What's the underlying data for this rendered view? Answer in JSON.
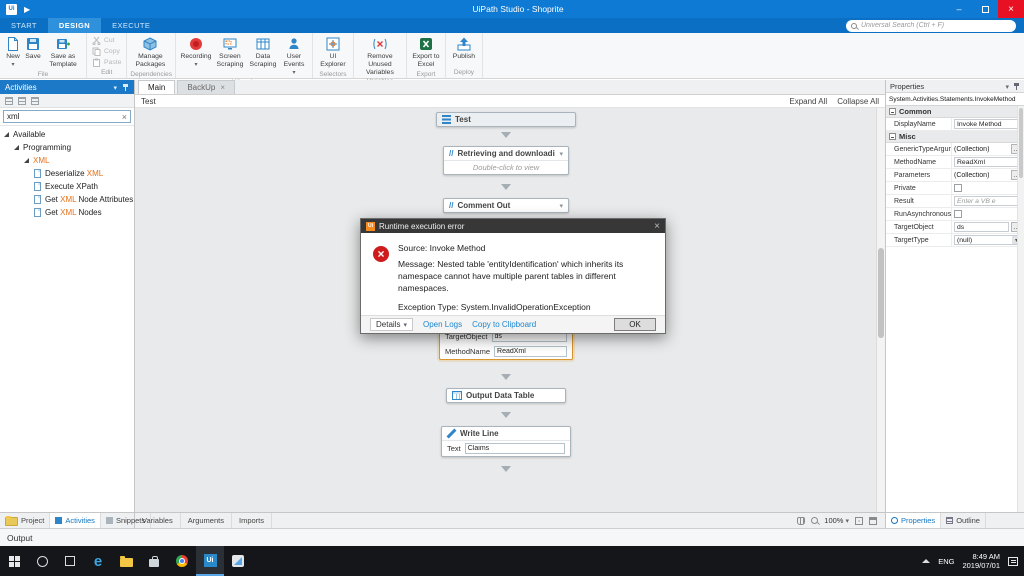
{
  "titlebar": {
    "title": "UiPath Studio - Shoprite"
  },
  "ribbon": {
    "tabs": [
      {
        "label": "START"
      },
      {
        "label": "DESIGN"
      },
      {
        "label": "EXECUTE"
      }
    ],
    "search_placeholder": "Universal Search (Ctrl + F)",
    "file": {
      "new": "New",
      "save": "Save",
      "save_as_template": "Save as Template",
      "label": "File"
    },
    "edit": {
      "cut": "Cut",
      "copy": "Copy",
      "paste": "Paste",
      "label": "Edit"
    },
    "dependencies": {
      "manage_packages": "Manage Packages",
      "label": "Dependencies"
    },
    "wizards": {
      "recording": "Recording",
      "screen_scraping": "Screen Scraping",
      "data_scraping": "Data Scraping",
      "user_events": "User Events",
      "label": "Wizards"
    },
    "selectors": {
      "ui_explorer": "UI Explorer",
      "label": "Selectors"
    },
    "variables": {
      "remove_unused": "Remove Unused Variables",
      "label": "Variables"
    },
    "export": {
      "export_to_excel": "Export to Excel",
      "label": "Export"
    },
    "deploy": {
      "publish": "Publish",
      "label": "Deploy"
    }
  },
  "activities_panel": {
    "title": "Activities",
    "search_value": "xml",
    "tree": {
      "available": "Available",
      "programming": "Programming",
      "xml_group": "XML",
      "items": [
        {
          "pre": "Deserialize ",
          "match": "XML",
          "post": ""
        },
        {
          "pre": "Execute XPath",
          "match": "",
          "post": ""
        },
        {
          "pre": "Get ",
          "match": "XML",
          "post": " Node Attributes"
        },
        {
          "pre": "Get ",
          "match": "XML",
          "post": " Nodes"
        }
      ]
    }
  },
  "designer": {
    "tabs": {
      "main": "Main",
      "backup": "BackUp"
    },
    "breadcrumb": "Test",
    "expand_all": "Expand All",
    "collapse_all": "Collapse All",
    "sequence_title": "Test",
    "retrieve_title": "Retrieving and downloadin",
    "retrieve_subtitle": "Double-click to view",
    "comment_out_title": "Comment Out",
    "invoke_fields": [
      {
        "label": "TargetObject",
        "value": "ds"
      },
      {
        "label": "MethodName",
        "value": "ReadXml"
      }
    ],
    "output_data_table_title": "Output Data Table",
    "write_line_title": "Write Line",
    "write_line_label": "Text",
    "write_line_value": "Claims",
    "statusbar": {
      "variables": "Variables",
      "arguments": "Arguments",
      "imports": "Imports",
      "zoom": "100%"
    }
  },
  "dialog": {
    "title": "Runtime execution error",
    "source": "Source: Invoke Method",
    "message": "Message: Nested table 'entityIdentification' which inherits its namespace cannot have multiple parent tables in different namespaces.",
    "exception": "Exception Type: System.InvalidOperationException",
    "details_label": "Details",
    "open_logs": "Open Logs",
    "copy_to_clipboard": "Copy to Clipboard",
    "ok": "OK"
  },
  "properties_panel": {
    "title": "Properties",
    "class_name": "System.Activities.Statements.InvokeMethod",
    "common_label": "Common",
    "misc_label": "Misc",
    "rows": {
      "display_name": {
        "label": "DisplayName",
        "value": "Invoke Method"
      },
      "generic_type_arguments": {
        "label": "GenericTypeArguments",
        "value": "(Collection)"
      },
      "method_name": {
        "label": "MethodName",
        "value": "ReadXml"
      },
      "parameters": {
        "label": "Parameters",
        "value": "(Collection)"
      },
      "private": {
        "label": "Private"
      },
      "result": {
        "label": "Result",
        "placeholder": "Enter a VB e"
      },
      "run_asynchronously": {
        "label": "RunAsynchronously"
      },
      "target_object": {
        "label": "TargetObject",
        "value": "ds"
      },
      "target_type": {
        "label": "TargetType",
        "value": "(null)"
      }
    }
  },
  "bottom_bar": {
    "project": "Project",
    "activities": "Activities",
    "snippets": "Snippets",
    "properties": "Properties",
    "outline": "Outline"
  },
  "output_panel": {
    "title": "Output"
  },
  "taskbar": {
    "lang": "ENG",
    "time": "8:49 AM",
    "date": "2019/07/01"
  }
}
